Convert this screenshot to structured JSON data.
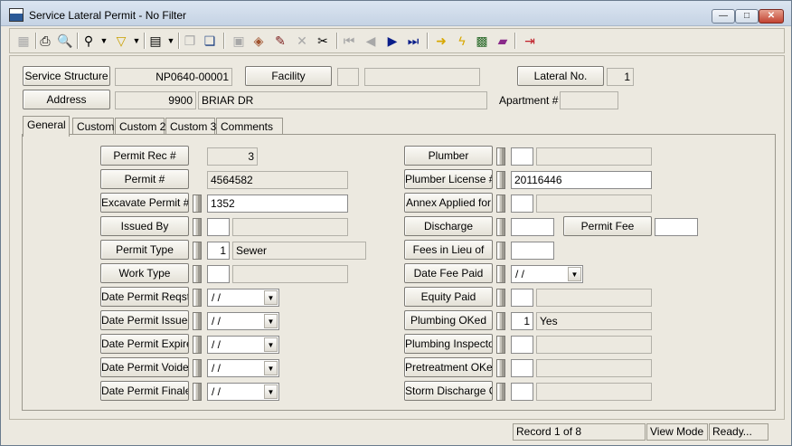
{
  "window": {
    "title": "Service Lateral Permit - No Filter",
    "min_label": "—",
    "max_label": "□",
    "close_label": "✕"
  },
  "toolbar": {
    "icons": [
      "grid-icon",
      "print-icon",
      "print-preview-icon",
      "binoculars-icon",
      "dropdown-arrow",
      "filter-icon",
      "dropdown-arrow",
      "report-icon",
      "dropdown-arrow",
      "copy-icon",
      "paste-icon",
      "save-icon",
      "stamp-icon",
      "edit-icon",
      "delete-icon",
      "cut-icon",
      "first-record-icon",
      "previous-record-icon",
      "next-record-icon",
      "last-record-icon",
      "arrow-right-icon",
      "lightning-icon",
      "map-icon",
      "book-icon",
      "exit-icon"
    ]
  },
  "header": {
    "service_structure_label": "Service Structure",
    "service_structure_value": "NP0640-00001",
    "facility_label": "Facility",
    "facility_code": "",
    "facility_value": "",
    "lateral_no_label": "Lateral No.",
    "lateral_no_value": "1",
    "address_label": "Address",
    "address_number": "9900",
    "address_street": "BRIAR DR",
    "apartment_label": "Apartment #",
    "apartment_value": ""
  },
  "tabs": [
    "General",
    "Custom",
    "Custom 2",
    "Custom 3",
    "Comments"
  ],
  "left": {
    "permit_rec_label": "Permit Rec #",
    "permit_rec_value": "3",
    "permit_no_label": "Permit #",
    "permit_no_value": "4564582",
    "excavate_label": "Excavate Permit #",
    "excavate_value": "1352",
    "issued_by_label": "Issued By",
    "issued_by_code": "",
    "issued_by_value": "",
    "permit_type_label": "Permit Type",
    "permit_type_code": "1",
    "permit_type_value": "Sewer",
    "work_type_label": "Work Type",
    "work_type_code": "",
    "work_type_value": "",
    "date_reqstd_label": "Date Permit Reqstd",
    "date_reqstd_value": " / /",
    "date_issued_label": "Date Permit Issued",
    "date_issued_value": " / /",
    "date_expired_label": "Date Permit Expired",
    "date_expired_value": " / /",
    "date_voided_label": "Date Permit Voided",
    "date_voided_value": " / /",
    "date_finaled_label": "Date Permit Finaled",
    "date_finaled_value": " / /"
  },
  "right": {
    "plumber_label": "Plumber",
    "plumber_code": "",
    "plumber_value": "",
    "plumber_license_label": "Plumber License #",
    "plumber_license_value": "20116446",
    "annex_label": "Annex Applied for",
    "annex_code": "",
    "annex_value": "",
    "discharge_label": "Discharge",
    "discharge_value": "",
    "permit_fee_label": "Permit Fee",
    "permit_fee_value": "",
    "fees_lieu_label": "Fees in Lieu of",
    "fees_lieu_value": "",
    "date_fee_paid_label": "Date Fee Paid",
    "date_fee_paid_value": " / /",
    "equity_paid_label": "Equity Paid",
    "equity_paid_code": "",
    "equity_paid_value": "",
    "plumbing_oked_label": "Plumbing OKed",
    "plumbing_oked_code": "1",
    "plumbing_oked_value": "Yes",
    "plumbing_inspector_label": "Plumbing Inspector",
    "plumbing_inspector_code": "",
    "plumbing_inspector_value": "",
    "pretreatment_label": "Pretreatment OKed",
    "pretreatment_code": "",
    "pretreatment_value": "",
    "storm_label": "Storm Discharge OK",
    "storm_code": "",
    "storm_value": ""
  },
  "status": {
    "record": "Record 1 of 8",
    "mode": "View Mode",
    "state": "Ready..."
  }
}
